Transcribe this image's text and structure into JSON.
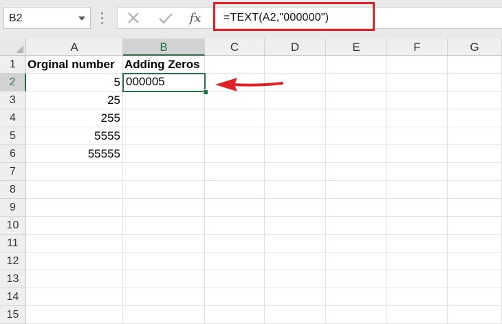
{
  "name_box": {
    "value": "B2"
  },
  "formula_bar": {
    "fx_label": "fx",
    "formula": "=TEXT(A2,\"000000\")",
    "icons": [
      "cancel-icon",
      "enter-check-icon",
      "insert-function-icon"
    ]
  },
  "columns": [
    "A",
    "B",
    "C",
    "D",
    "E",
    "F",
    "G"
  ],
  "rows": [
    "1",
    "2",
    "3",
    "4",
    "5",
    "6",
    "7",
    "8",
    "9",
    "10",
    "11",
    "12",
    "13",
    "14",
    "15"
  ],
  "selection": {
    "column": "B",
    "row": "2"
  },
  "cells": {
    "A1": "Orginal number",
    "B1": "Adding Zeros",
    "A2": "5",
    "B2": "000005",
    "A3": "25",
    "A4": "255",
    "A5": "5555",
    "A6": "55555"
  },
  "colors": {
    "accent": "#217346",
    "annotation": "#e02127"
  }
}
